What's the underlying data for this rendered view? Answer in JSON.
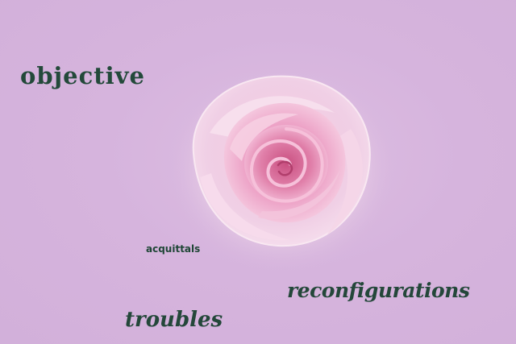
{
  "words": {
    "objective": "objective",
    "acquittals": "acquittals",
    "reconfigurations": "reconfigurations",
    "troubles": "troubles"
  },
  "colors": {
    "background": "#d6b4dd",
    "text": "#23493a",
    "rose_light": "#f6d7ea",
    "rose_mid": "#eaa1c6",
    "rose_deep": "#d56593"
  },
  "image_subject": "pink-rose-icon"
}
